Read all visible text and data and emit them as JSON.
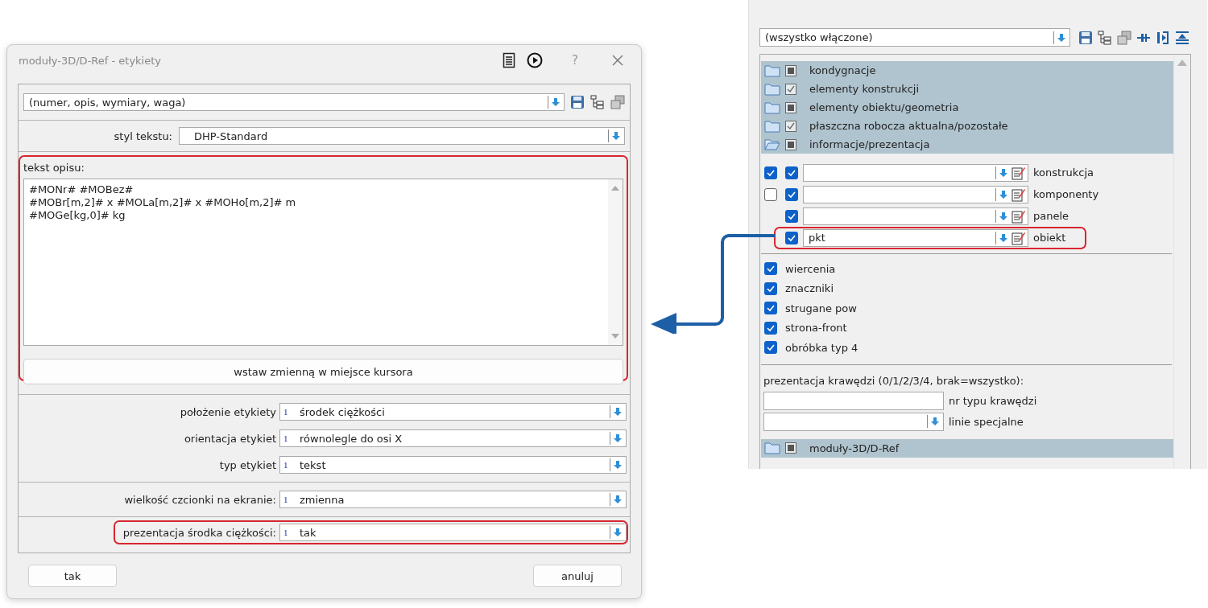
{
  "dialog": {
    "title": "moduły-3D/D-Ref - etykiety",
    "help": "?",
    "preset": {
      "value": "(numer, opis, wymiary, waga)"
    },
    "text_style": {
      "label": "styl tekstu:",
      "value": "DHP-Standard"
    },
    "description": {
      "label": "tekst opisu:",
      "highlighted": true,
      "lines": [
        "#MONr# #MOBez#",
        "#MOBr[m,2]# x #MOLa[m,2]# x #MOHo[m,2]# m",
        "#MOGe[kg,0]# kg"
      ]
    },
    "insert_button": "wstaw zmienną w miejsce kursora",
    "groups": [
      [
        {
          "label": "położenie etykiety",
          "index": "1",
          "value": "środek ciężkości",
          "highlighted": false
        },
        {
          "label": "orientacja etykiet",
          "index": "1",
          "value": "równolegle do osi X",
          "highlighted": false
        },
        {
          "label": "typ etykiet",
          "index": "1",
          "value": "tekst",
          "highlighted": false
        }
      ],
      [
        {
          "label": "wielkość czcionki na ekranie:",
          "index": "1",
          "value": "zmienna",
          "highlighted": false
        }
      ],
      [
        {
          "label": "prezentacja środka ciężkości:",
          "index": "1",
          "value": "tak",
          "highlighted": true
        }
      ]
    ],
    "buttons": [
      {
        "label": "tak"
      },
      {
        "label": "anuluj"
      }
    ]
  },
  "layers": {
    "filter": {
      "value": "(wszystko włączone)"
    },
    "groups": [
      {
        "label": "kondygnacje",
        "checked": false,
        "mixed": true,
        "open": false
      },
      {
        "label": "elementy konstrukcji",
        "checked": true,
        "mixed": false,
        "open": false
      },
      {
        "label": "elementy obiektu/geometria",
        "checked": false,
        "mixed": true,
        "open": false
      },
      {
        "label": "płaszczna robocza aktualna/pozostałe",
        "checked": true,
        "mixed": false,
        "open": false
      },
      {
        "label": "informacje/prezentacja",
        "checked": false,
        "mixed": true,
        "open": true
      }
    ],
    "rows": [
      {
        "label": "konstrukcja",
        "visible": true,
        "active": true,
        "highlighted": false
      },
      {
        "label": "komponenty",
        "visible": false,
        "active": true,
        "highlighted": false
      },
      {
        "label": "panele",
        "active": true,
        "highlighted": false
      },
      {
        "label": "obiekt",
        "active": true,
        "value": "pkt",
        "highlighted": true
      }
    ],
    "options": [
      {
        "label": "wiercenia",
        "checked": true
      },
      {
        "label": "znaczniki",
        "checked": true
      },
      {
        "label": "strugane pow",
        "checked": true
      },
      {
        "label": "strona-front",
        "checked": true
      },
      {
        "label": "obróbka typ 4",
        "checked": true
      }
    ],
    "edge_section": {
      "label": "prezentacja krawędzi (0/1/2/3/4, brak=wszystko):",
      "fields": [
        {
          "label": "nr typu krawędzi",
          "kind": "text"
        },
        {
          "label": "linie specjalne",
          "kind": "combo"
        }
      ]
    },
    "footer_group": {
      "label": "moduły-3D/D-Ref",
      "checked": false,
      "mixed": true,
      "open": false
    }
  }
}
